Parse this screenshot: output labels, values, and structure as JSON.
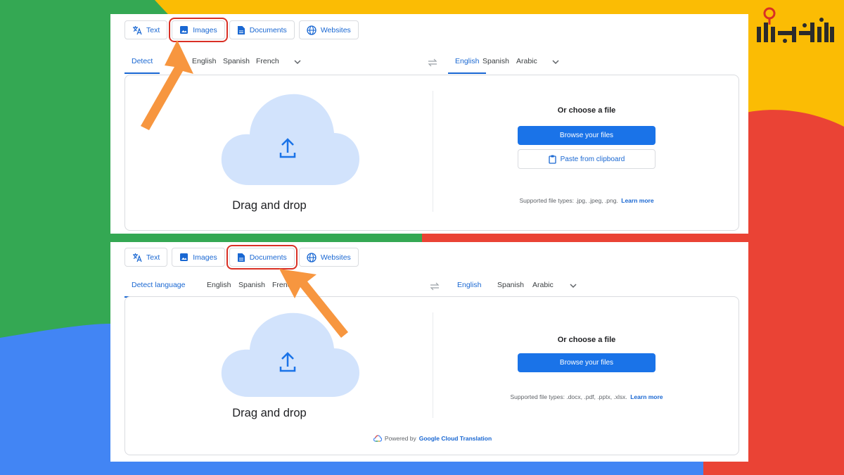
{
  "colors": {
    "green": "#34a853",
    "yellow": "#fbbc04",
    "red": "#ea4335",
    "blue": "#4285f4",
    "accent": "#1a73e8",
    "highlight": "#d93025",
    "arrow": "#f7963f"
  },
  "logo": {
    "text": "آی‌تی‌باز",
    "icon": "keyhole-logo-icon"
  },
  "top_panel": {
    "modes": [
      {
        "label": "Text",
        "icon": "translate-icon",
        "selected": false
      },
      {
        "label": "Images",
        "icon": "image-icon",
        "selected": true
      },
      {
        "label": "Documents",
        "icon": "document-icon",
        "selected": false
      },
      {
        "label": "Websites",
        "icon": "globe-icon",
        "selected": false
      }
    ],
    "source_langs": [
      "Detect language",
      "English",
      "Spanish",
      "French"
    ],
    "source_active_visible": "Detect",
    "target_langs": [
      "English",
      "Spanish",
      "Arabic"
    ],
    "drag_text": "Drag and drop",
    "choose_text": "Or choose a file",
    "browse_label": "Browse your files",
    "paste_label": "Paste from clipboard",
    "supported": "Supported file types: .jpg, .jpeg, .png.",
    "learn_more": "Learn more"
  },
  "bottom_panel": {
    "modes": [
      {
        "label": "Text",
        "icon": "translate-icon",
        "selected": false
      },
      {
        "label": "Images",
        "icon": "image-icon",
        "selected": false
      },
      {
        "label": "Documents",
        "icon": "document-icon",
        "selected": true
      },
      {
        "label": "Websites",
        "icon": "globe-icon",
        "selected": false
      }
    ],
    "source_langs": [
      "Detect language",
      "English",
      "Spanish",
      "French"
    ],
    "target_langs": [
      "English",
      "Spanish",
      "Arabic"
    ],
    "drag_text": "Drag and drop",
    "choose_text": "Or choose a file",
    "browse_label": "Browse your files",
    "supported": "Supported file types: .docx, .pdf, .pptx, .xlsx.",
    "learn_more": "Learn more",
    "powered_prefix": "Powered by",
    "powered_brand": "Google Cloud Translation"
  }
}
